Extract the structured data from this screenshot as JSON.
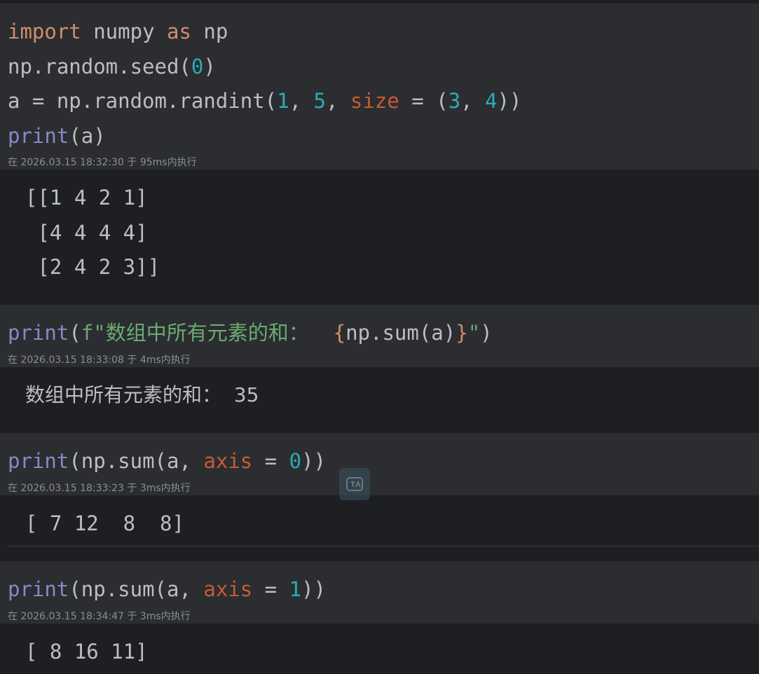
{
  "cells": [
    {
      "code": {
        "line1": {
          "t1": "import",
          "t2": " numpy ",
          "t3": "as",
          "t4": " np"
        },
        "line2": {
          "t1": "np.random.seed(",
          "t2": "0",
          "t3": ")"
        },
        "line3": {
          "t1": "a = np.random.randint(",
          "t2": "1",
          "t3": ", ",
          "t4": "5",
          "t5": ", ",
          "t6": "size",
          "t7": " = (",
          "t8": "3",
          "t9": ", ",
          "t10": "4",
          "t11": "))"
        },
        "line4": {
          "t1": "print",
          "t2": "(a)"
        }
      },
      "meta": "在 2026.03.15 18:32:30 于 95ms内执行",
      "output": [
        "[[1 4 2 1]",
        " [4 4 4 4]",
        " [2 4 2 3]]"
      ]
    },
    {
      "code": {
        "line1": {
          "t1": "print",
          "t2": "(",
          "t3": "f\"数组中所有元素的和：  ",
          "t4": "{",
          "t5": "np.sum(a)",
          "t6": "}",
          "t7": "\"",
          "t8": ")"
        }
      },
      "meta": "在 2026.03.15 18:33:08 于 4ms内执行",
      "output": [
        "数组中所有元素的和：  35"
      ]
    },
    {
      "code": {
        "line1": {
          "t1": "print",
          "t2": "(np.sum(a, ",
          "t3": "axis",
          "t4": " = ",
          "t5": "0",
          "t6": "))"
        }
      },
      "meta": "在 2026.03.15 18:33:23 于 3ms内执行",
      "output": [
        "[ 7 12  8  8]"
      ]
    },
    {
      "code": {
        "line1": {
          "t1": "print",
          "t2": "(np.sum(a, ",
          "t3": "axis",
          "t4": " = ",
          "t5": "1",
          "t6": "))"
        }
      },
      "meta": "在 2026.03.15 18:34:47 于 3ms内执行",
      "output": [
        "[ 8 16 11]"
      ]
    }
  ],
  "floating_badge": {
    "icon": "translate-icon"
  },
  "colors": {
    "keyword": "#cf8e6d",
    "builtin": "#8888c6",
    "number": "#2aacb8",
    "param": "#c75a36",
    "string": "#6aab73",
    "code_bg": "#2b2d30",
    "output_bg": "#1e1f22"
  }
}
